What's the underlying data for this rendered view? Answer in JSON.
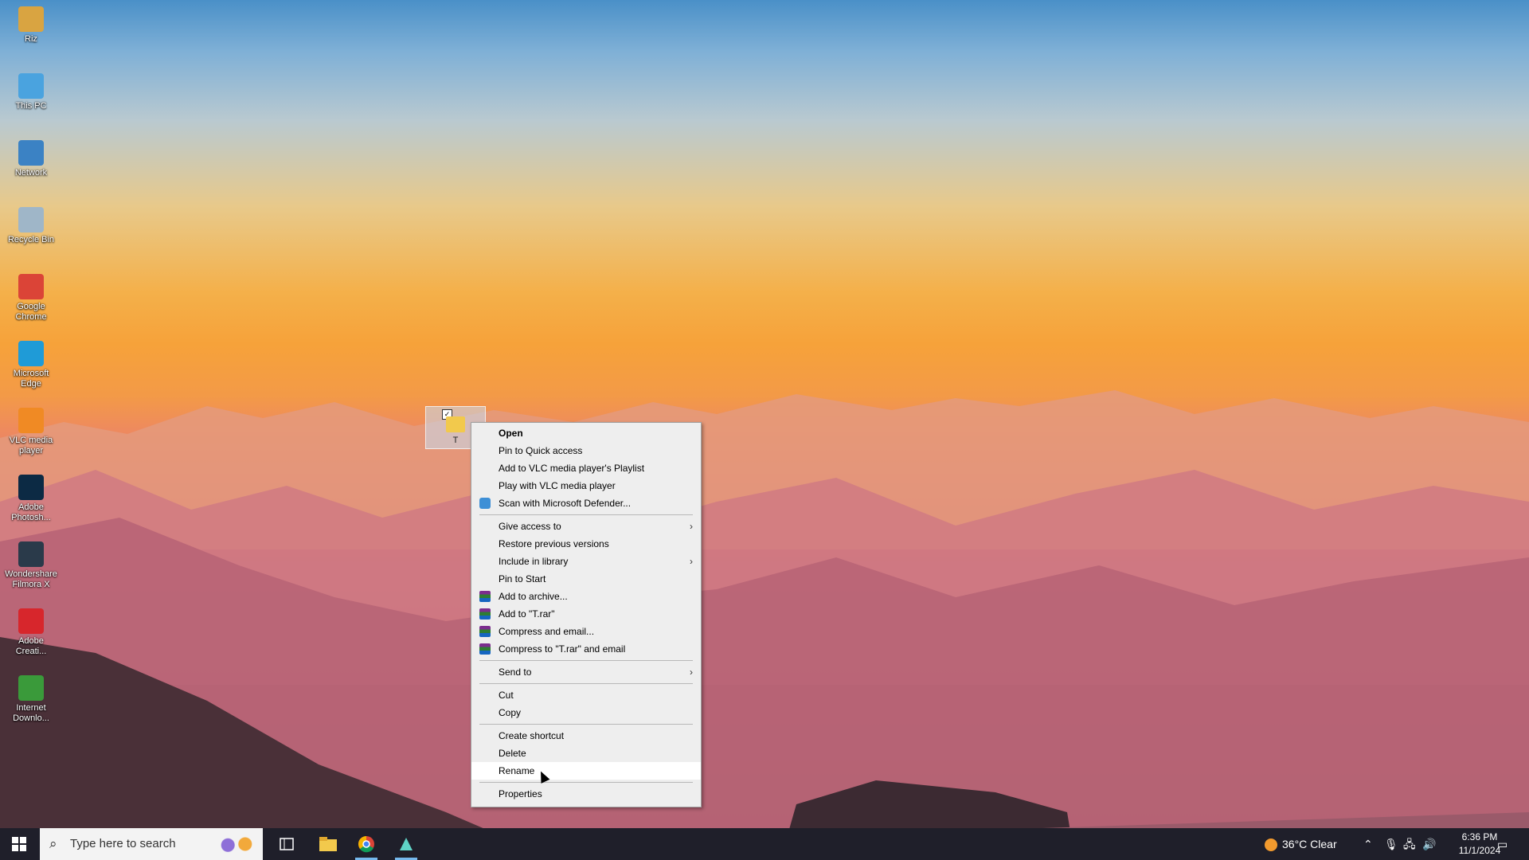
{
  "desktop_icons": [
    {
      "label": "Riz",
      "icon": "user-folder-icon",
      "color": "#d9a441"
    },
    {
      "label": "This PC",
      "icon": "computer-icon",
      "color": "#4aa3df"
    },
    {
      "label": "Network",
      "icon": "network-icon",
      "color": "#3b82c4"
    },
    {
      "label": "Recycle Bin",
      "icon": "recycle-bin-icon",
      "color": "#9fb6c8"
    },
    {
      "label": "Google Chrome",
      "icon": "chrome-icon",
      "color": "#db4437"
    },
    {
      "label": "Microsoft Edge",
      "icon": "edge-icon",
      "color": "#1f9bd7"
    },
    {
      "label": "VLC media player",
      "icon": "vlc-icon",
      "color": "#f08a24"
    },
    {
      "label": "Adobe Photosh...",
      "icon": "photoshop-icon",
      "color": "#0c2a44"
    },
    {
      "label": "Wondershare Filmora X",
      "icon": "filmora-icon",
      "color": "#2a3a4a"
    },
    {
      "label": "Adobe Creati...",
      "icon": "adobe-cc-icon",
      "color": "#d7262c"
    },
    {
      "label": "Internet Downlo...",
      "icon": "idm-icon",
      "color": "#3a9a3a"
    }
  ],
  "selected_folder": {
    "label": "T"
  },
  "context_menu": {
    "items": [
      {
        "label": "Open",
        "bold": true
      },
      {
        "label": "Pin to Quick access"
      },
      {
        "label": "Add to VLC media player's Playlist"
      },
      {
        "label": "Play with VLC media player"
      },
      {
        "label": "Scan with Microsoft Defender...",
        "icon": "defender-icon"
      },
      {
        "sep": true
      },
      {
        "label": "Give access to",
        "submenu": true
      },
      {
        "label": "Restore previous versions"
      },
      {
        "label": "Include in library",
        "submenu": true
      },
      {
        "label": "Pin to Start"
      },
      {
        "label": "Add to archive...",
        "icon": "winrar-icon"
      },
      {
        "label": "Add to \"T.rar\"",
        "icon": "winrar-icon"
      },
      {
        "label": "Compress and email...",
        "icon": "winrar-icon"
      },
      {
        "label": "Compress to \"T.rar\" and email",
        "icon": "winrar-icon"
      },
      {
        "sep": true
      },
      {
        "label": "Send to",
        "submenu": true
      },
      {
        "sep": true
      },
      {
        "label": "Cut"
      },
      {
        "label": "Copy"
      },
      {
        "sep": true
      },
      {
        "label": "Create shortcut"
      },
      {
        "label": "Delete"
      },
      {
        "label": "Rename",
        "hover": true
      },
      {
        "sep": true
      },
      {
        "label": "Properties"
      }
    ]
  },
  "taskbar": {
    "search_placeholder": "Type here to search",
    "weather": "36°C  Clear",
    "time": "6:36 PM",
    "date": "11/1/2024"
  }
}
